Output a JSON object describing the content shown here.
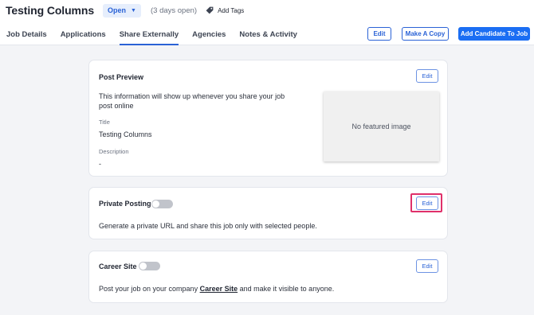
{
  "header": {
    "job_title": "Testing Columns",
    "status": "Open",
    "days_open": "(3 days open)",
    "add_tags": "Add Tags",
    "tabs": [
      "Job Details",
      "Applications",
      "Share Externally",
      "Agencies",
      "Notes & Activity"
    ],
    "active_tab": "Share Externally",
    "buttons": {
      "edit": "Edit",
      "make_copy": "Make A Copy",
      "add_candidate": "Add Candidate To Job"
    }
  },
  "post_preview": {
    "title": "Post Preview",
    "edit": "Edit",
    "intro_line1": "This information will show up whenever you share your job",
    "intro_line2": "post online",
    "title_label": "Title",
    "title_value": "Testing Columns",
    "description_label": "Description",
    "description_value": "-",
    "featured_image": "No featured image"
  },
  "private_posting": {
    "title": "Private Posting",
    "edit": "Edit",
    "enabled": false,
    "description": "Generate a private URL and share this job only with selected people."
  },
  "career_site": {
    "title": "Career Site",
    "edit": "Edit",
    "enabled": false,
    "text_before": "Post your job on your company",
    "link": "Career Site",
    "text_after": "and make it visible to anyone."
  },
  "colors": {
    "accent": "#2a62d6",
    "primary_button": "#1b6ef3",
    "highlight": "#e0306a",
    "background": "#f3f4f7"
  }
}
